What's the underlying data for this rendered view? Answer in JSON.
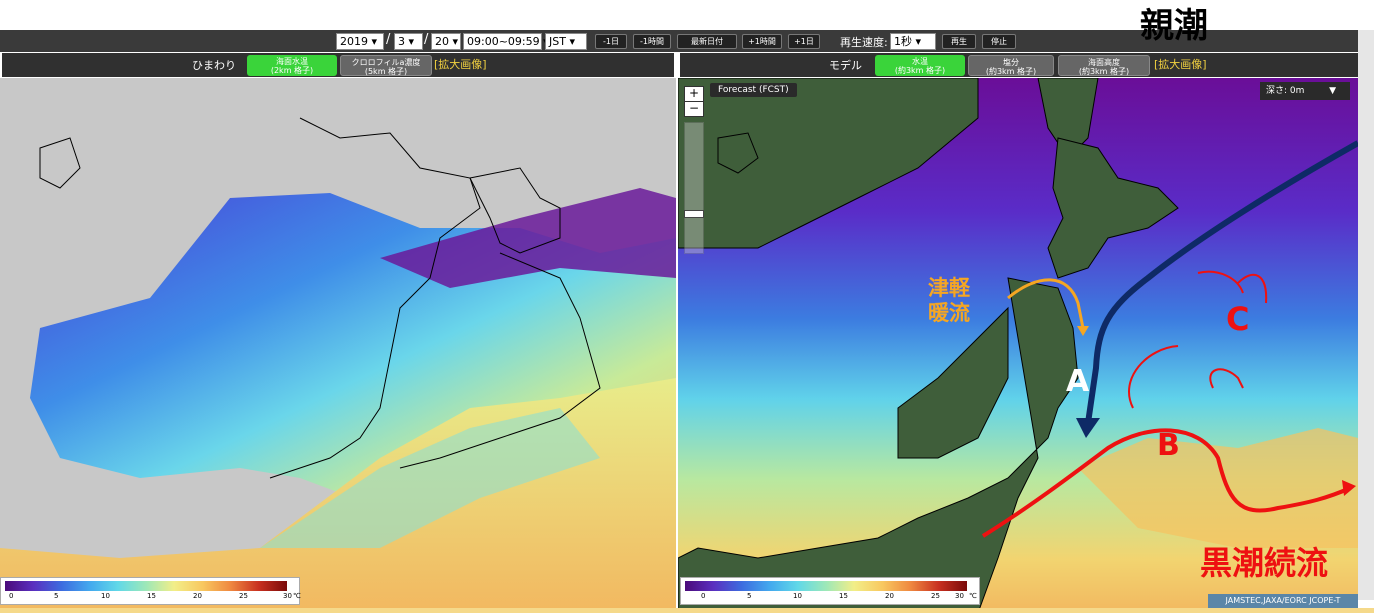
{
  "controls": {
    "year": "2019",
    "month": "3",
    "day": "20",
    "hour": "09:00~09:59",
    "timezone": "JST",
    "date_sep_1": "/",
    "date_sep_2": "/",
    "buttons": {
      "minus_day": "-1日",
      "minus_hour": "-1時間",
      "latest_date": "最新日付",
      "plus_hour": "+1時間",
      "plus_day": "+1日"
    },
    "speed_label": "再生速度:",
    "speed_value": "1秒",
    "play": "再生",
    "stop": "停止"
  },
  "left_panel": {
    "source_label": "ひまわり",
    "tab_sst_line1": "海面水温",
    "tab_sst_line2": "(2km 格子)",
    "tab_chl_line1": "クロロフィルa濃度",
    "tab_chl_line2": "(5km 格子)",
    "zoom_link": "[拡大画像]",
    "colorbar_ticks": [
      "0",
      "5",
      "10",
      "15",
      "20",
      "25",
      "30"
    ],
    "colorbar_unit": "℃"
  },
  "right_panel": {
    "source_label": "モデル",
    "tab_temp_line1": "水温",
    "tab_temp_line2": "(約3km 格子)",
    "tab_sal_line1": "塩分",
    "tab_sal_line2": "(約3km 格子)",
    "tab_ssh_line1": "海面高度",
    "tab_ssh_line2": "(約3km 格子)",
    "zoom_link": "[拡大画像]",
    "forecast_label": "Forecast (FCST)",
    "depth_label": "深さ:",
    "depth_value": "0m",
    "zoom_in": "+",
    "zoom_out": "−",
    "colorbar_ticks": [
      "0",
      "5",
      "10",
      "15",
      "20",
      "25",
      "30"
    ],
    "colorbar_unit": "℃",
    "credit": "JAMSTEC,JAXA/EORC JCOPE-T"
  },
  "annotations": {
    "oyashio": "親潮",
    "tsugaru_line1": "津軽",
    "tsugaru_line2": "暖流",
    "label_a": "A",
    "label_b": "B",
    "label_c": "C",
    "kuroshio_ext": "黒潮続流"
  },
  "colors": {
    "oyashio": "#0e2a66",
    "tsugaru": "#f5a623",
    "kuroshio": "#ee1111",
    "land": "#3f5e3a",
    "tab_active": "#3ad43a"
  }
}
